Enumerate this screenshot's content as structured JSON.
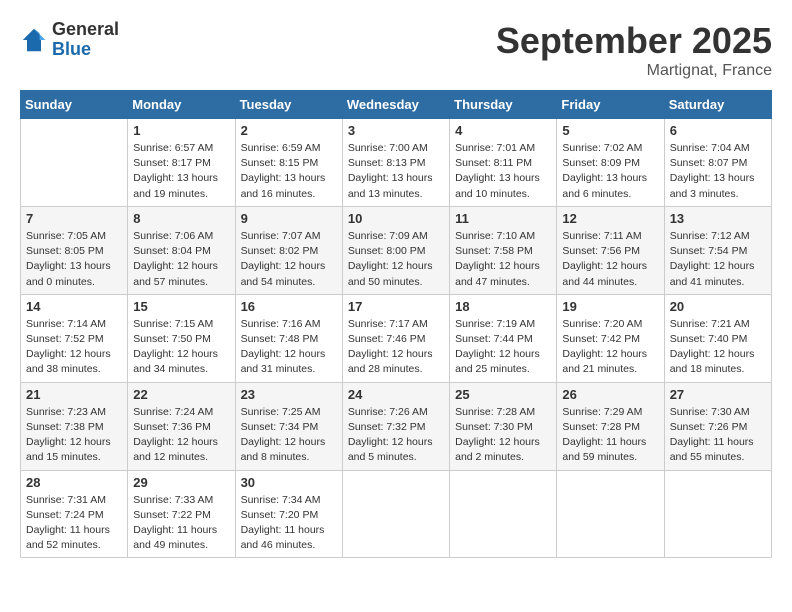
{
  "header": {
    "logo_general": "General",
    "logo_blue": "Blue",
    "title": "September 2025",
    "location": "Martignat, France"
  },
  "days_of_week": [
    "Sunday",
    "Monday",
    "Tuesday",
    "Wednesday",
    "Thursday",
    "Friday",
    "Saturday"
  ],
  "weeks": [
    [
      {
        "day": "",
        "info": ""
      },
      {
        "day": "1",
        "info": "Sunrise: 6:57 AM\nSunset: 8:17 PM\nDaylight: 13 hours\nand 19 minutes."
      },
      {
        "day": "2",
        "info": "Sunrise: 6:59 AM\nSunset: 8:15 PM\nDaylight: 13 hours\nand 16 minutes."
      },
      {
        "day": "3",
        "info": "Sunrise: 7:00 AM\nSunset: 8:13 PM\nDaylight: 13 hours\nand 13 minutes."
      },
      {
        "day": "4",
        "info": "Sunrise: 7:01 AM\nSunset: 8:11 PM\nDaylight: 13 hours\nand 10 minutes."
      },
      {
        "day": "5",
        "info": "Sunrise: 7:02 AM\nSunset: 8:09 PM\nDaylight: 13 hours\nand 6 minutes."
      },
      {
        "day": "6",
        "info": "Sunrise: 7:04 AM\nSunset: 8:07 PM\nDaylight: 13 hours\nand 3 minutes."
      }
    ],
    [
      {
        "day": "7",
        "info": "Sunrise: 7:05 AM\nSunset: 8:05 PM\nDaylight: 13 hours\nand 0 minutes."
      },
      {
        "day": "8",
        "info": "Sunrise: 7:06 AM\nSunset: 8:04 PM\nDaylight: 12 hours\nand 57 minutes."
      },
      {
        "day": "9",
        "info": "Sunrise: 7:07 AM\nSunset: 8:02 PM\nDaylight: 12 hours\nand 54 minutes."
      },
      {
        "day": "10",
        "info": "Sunrise: 7:09 AM\nSunset: 8:00 PM\nDaylight: 12 hours\nand 50 minutes."
      },
      {
        "day": "11",
        "info": "Sunrise: 7:10 AM\nSunset: 7:58 PM\nDaylight: 12 hours\nand 47 minutes."
      },
      {
        "day": "12",
        "info": "Sunrise: 7:11 AM\nSunset: 7:56 PM\nDaylight: 12 hours\nand 44 minutes."
      },
      {
        "day": "13",
        "info": "Sunrise: 7:12 AM\nSunset: 7:54 PM\nDaylight: 12 hours\nand 41 minutes."
      }
    ],
    [
      {
        "day": "14",
        "info": "Sunrise: 7:14 AM\nSunset: 7:52 PM\nDaylight: 12 hours\nand 38 minutes."
      },
      {
        "day": "15",
        "info": "Sunrise: 7:15 AM\nSunset: 7:50 PM\nDaylight: 12 hours\nand 34 minutes."
      },
      {
        "day": "16",
        "info": "Sunrise: 7:16 AM\nSunset: 7:48 PM\nDaylight: 12 hours\nand 31 minutes."
      },
      {
        "day": "17",
        "info": "Sunrise: 7:17 AM\nSunset: 7:46 PM\nDaylight: 12 hours\nand 28 minutes."
      },
      {
        "day": "18",
        "info": "Sunrise: 7:19 AM\nSunset: 7:44 PM\nDaylight: 12 hours\nand 25 minutes."
      },
      {
        "day": "19",
        "info": "Sunrise: 7:20 AM\nSunset: 7:42 PM\nDaylight: 12 hours\nand 21 minutes."
      },
      {
        "day": "20",
        "info": "Sunrise: 7:21 AM\nSunset: 7:40 PM\nDaylight: 12 hours\nand 18 minutes."
      }
    ],
    [
      {
        "day": "21",
        "info": "Sunrise: 7:23 AM\nSunset: 7:38 PM\nDaylight: 12 hours\nand 15 minutes."
      },
      {
        "day": "22",
        "info": "Sunrise: 7:24 AM\nSunset: 7:36 PM\nDaylight: 12 hours\nand 12 minutes."
      },
      {
        "day": "23",
        "info": "Sunrise: 7:25 AM\nSunset: 7:34 PM\nDaylight: 12 hours\nand 8 minutes."
      },
      {
        "day": "24",
        "info": "Sunrise: 7:26 AM\nSunset: 7:32 PM\nDaylight: 12 hours\nand 5 minutes."
      },
      {
        "day": "25",
        "info": "Sunrise: 7:28 AM\nSunset: 7:30 PM\nDaylight: 12 hours\nand 2 minutes."
      },
      {
        "day": "26",
        "info": "Sunrise: 7:29 AM\nSunset: 7:28 PM\nDaylight: 11 hours\nand 59 minutes."
      },
      {
        "day": "27",
        "info": "Sunrise: 7:30 AM\nSunset: 7:26 PM\nDaylight: 11 hours\nand 55 minutes."
      }
    ],
    [
      {
        "day": "28",
        "info": "Sunrise: 7:31 AM\nSunset: 7:24 PM\nDaylight: 11 hours\nand 52 minutes."
      },
      {
        "day": "29",
        "info": "Sunrise: 7:33 AM\nSunset: 7:22 PM\nDaylight: 11 hours\nand 49 minutes."
      },
      {
        "day": "30",
        "info": "Sunrise: 7:34 AM\nSunset: 7:20 PM\nDaylight: 11 hours\nand 46 minutes."
      },
      {
        "day": "",
        "info": ""
      },
      {
        "day": "",
        "info": ""
      },
      {
        "day": "",
        "info": ""
      },
      {
        "day": "",
        "info": ""
      }
    ]
  ]
}
